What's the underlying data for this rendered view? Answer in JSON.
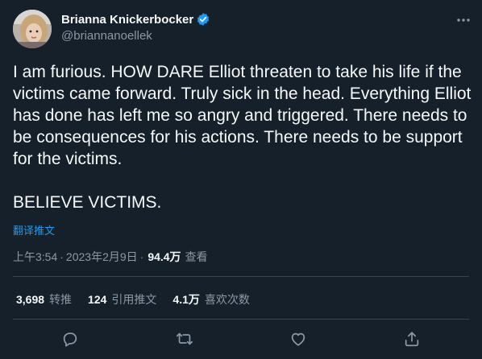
{
  "author": {
    "display_name": "Brianna Knickerbocker",
    "handle": "@briannanoellek",
    "verified": true,
    "avatar_icon": "user-avatar"
  },
  "tweet": {
    "text": "I am furious. HOW DARE Elliot threaten to take his life if the victims came forward. Truly sick in the head. Everything Elliot has done has left me so angry and triggered. There needs to be consequences for his actions. There needs to be support for the victims.\n\nBELIEVE VICTIMS.",
    "translate_label": "翻译推文",
    "time": "上午3:54",
    "separator": "·",
    "date": "2023年2月9日",
    "dot": "·",
    "views_count": "94.4万",
    "views_label": "查看"
  },
  "stats": {
    "retweets_count": "3,698",
    "retweets_label": "转推",
    "quotes_count": "124",
    "quotes_label": "引用推文",
    "likes_count": "4.1万",
    "likes_label": "喜欢次数"
  },
  "actions": {
    "reply_icon": "reply-icon",
    "retweet_icon": "retweet-icon",
    "like_icon": "heart-icon",
    "share_icon": "share-icon",
    "more_icon": "more-horizontal-icon"
  },
  "colors": {
    "background": "#15202b",
    "accent": "#1d9bf0",
    "text": "#f7f9f9",
    "muted": "#8b98a5",
    "divider": "#38444d"
  }
}
